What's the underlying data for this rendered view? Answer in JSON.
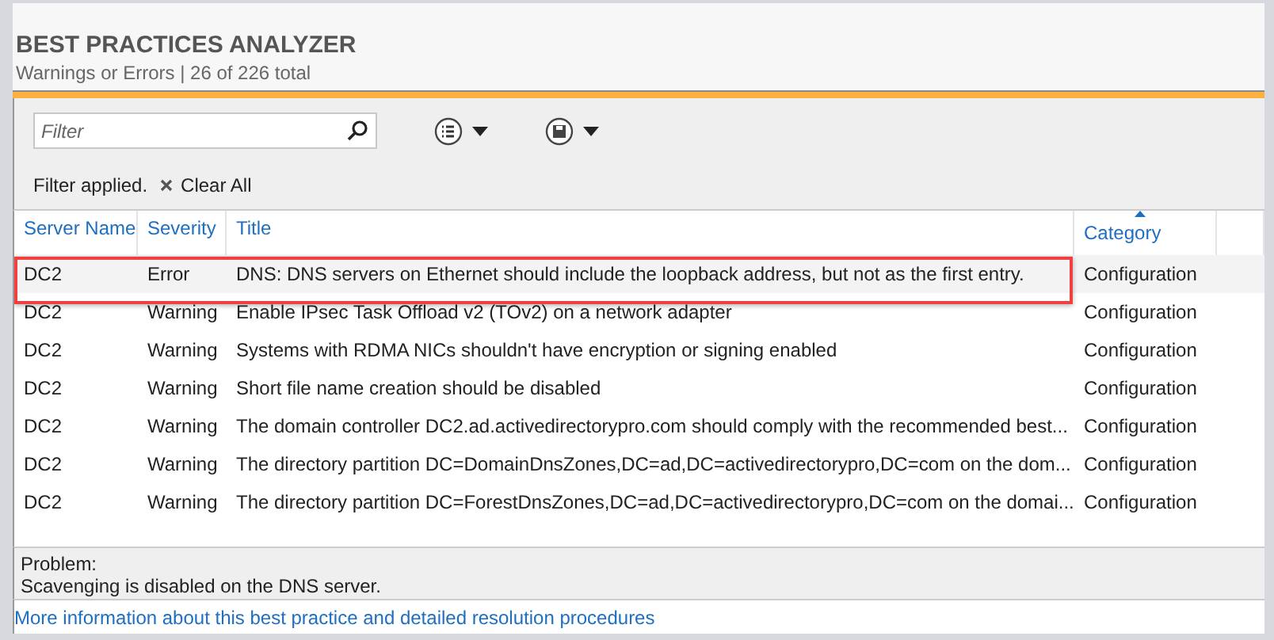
{
  "header": {
    "title": "BEST PRACTICES ANALYZER",
    "subtitle": "Warnings or Errors | 26 of 226 total"
  },
  "toolbar": {
    "filter": {
      "placeholder": "Filter"
    },
    "filter_status": "Filter applied.",
    "clear_button": "Clear All"
  },
  "table": {
    "columns": [
      {
        "label": "Server Name",
        "sorted": false
      },
      {
        "label": "Severity",
        "sorted": false
      },
      {
        "label": "Title",
        "sorted": false
      },
      {
        "label": "Category",
        "sorted": true
      }
    ],
    "rows": [
      {
        "server": "DC2",
        "severity": "Error",
        "title": "DNS: DNS servers on Ethernet should include the loopback address, but not as the first entry.",
        "category": "Configuration",
        "selected": true,
        "highlighted": true
      },
      {
        "server": "DC2",
        "severity": "Warning",
        "title": "Enable IPsec Task Offload v2 (TOv2) on a network adapter",
        "category": "Configuration",
        "selected": false,
        "highlighted": false
      },
      {
        "server": "DC2",
        "severity": "Warning",
        "title": "Systems with RDMA NICs shouldn't have encryption or signing enabled",
        "category": "Configuration",
        "selected": false,
        "highlighted": false
      },
      {
        "server": "DC2",
        "severity": "Warning",
        "title": "Short file name creation should be disabled",
        "category": "Configuration",
        "selected": false,
        "highlighted": false
      },
      {
        "server": "DC2",
        "severity": "Warning",
        "title": "The domain controller DC2.ad.activedirectorypro.com should comply with the recommended best...",
        "category": "Configuration",
        "selected": false,
        "highlighted": false
      },
      {
        "server": "DC2",
        "severity": "Warning",
        "title": "The directory partition DC=DomainDnsZones,DC=ad,DC=activedirectorypro,DC=com on the dom...",
        "category": "Configuration",
        "selected": false,
        "highlighted": false
      },
      {
        "server": "DC2",
        "severity": "Warning",
        "title": "The directory partition DC=ForestDnsZones,DC=ad,DC=activedirectorypro,DC=com on the domai...",
        "category": "Configuration",
        "selected": false,
        "highlighted": false
      }
    ]
  },
  "details": {
    "label": "Problem:",
    "text": "Scavenging is disabled on the DNS server.",
    "link": "More information about this best practice and detailed resolution procedures"
  }
}
